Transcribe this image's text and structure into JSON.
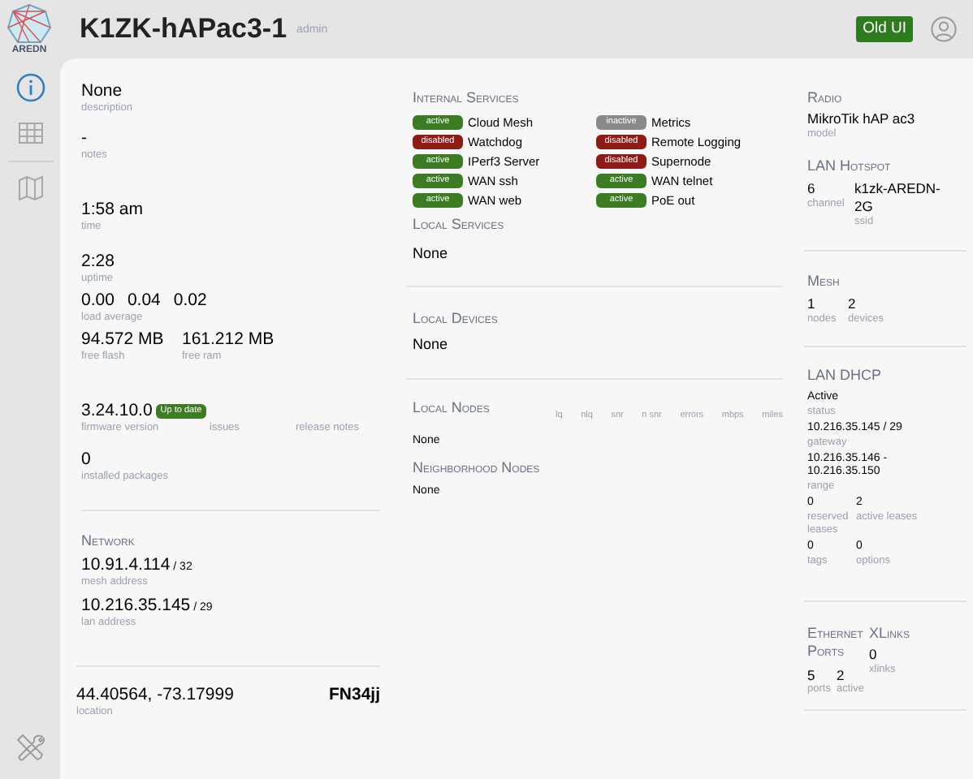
{
  "header": {
    "logo_text": "AREDN",
    "title": "K1ZK-hAPac3-1",
    "role": "admin",
    "old_ui_button": "Old UI"
  },
  "sidebar": {
    "items": [
      {
        "kind": "info",
        "selected": true
      },
      {
        "kind": "table",
        "selected": false
      },
      {
        "kind": "map",
        "selected": false
      }
    ]
  },
  "general": {
    "description": {
      "value": "None",
      "label": "description"
    },
    "notes": {
      "value": "-",
      "label": "notes"
    },
    "time": {
      "value": "1:58 am",
      "label": "time"
    },
    "uptime": {
      "value": "2:28",
      "label": "uptime"
    },
    "load_average": {
      "values": [
        "0.00",
        "0.04",
        "0.02"
      ],
      "label": "load average"
    },
    "memory": [
      {
        "value": "94.572 MB",
        "label": "free flash"
      },
      {
        "value": "161.212 MB",
        "label": "free ram"
      }
    ],
    "firmware": {
      "value": "3.24.10.0",
      "badge": "Up to date",
      "label": "firmware version",
      "issues": "issues",
      "release_notes": "release notes"
    },
    "packages": {
      "value": "0",
      "label": "installed packages"
    }
  },
  "network": {
    "title": "Network",
    "addresses": [
      {
        "value": "10.91.4.114",
        "mask": "/ 32",
        "label": "mesh address"
      },
      {
        "value": "10.216.35.145",
        "mask": "/ 29",
        "label": "lan address"
      }
    ]
  },
  "location": {
    "coordinates": "44.40564, -73.17999",
    "label": "location",
    "grid_square": "FN34jj"
  },
  "internal_services": {
    "title": "Internal Services",
    "columns": [
      [
        {
          "status": "active",
          "name": "Cloud Mesh"
        },
        {
          "status": "disabled",
          "name": "Watchdog"
        },
        {
          "status": "active",
          "name": "IPerf3 Server"
        },
        {
          "status": "active",
          "name": "WAN ssh"
        },
        {
          "status": "active",
          "name": "WAN web"
        }
      ],
      [
        {
          "status": "inactive",
          "name": "Metrics"
        },
        {
          "status": "disabled",
          "name": "Remote Logging"
        },
        {
          "status": "disabled",
          "name": "Supernode"
        },
        {
          "status": "active",
          "name": "WAN telnet"
        },
        {
          "status": "active",
          "name": "PoE out"
        }
      ]
    ]
  },
  "local_services": {
    "title": "Local Services",
    "value": "None"
  },
  "local_devices": {
    "title": "Local Devices",
    "value": "None"
  },
  "local_nodes": {
    "title": "Local Nodes",
    "columns": [
      "lq",
      "nlq",
      "snr",
      "n snr",
      "errors",
      "mbps",
      "miles"
    ],
    "value": "None"
  },
  "neighborhood_nodes": {
    "title": "Neighborhood Nodes",
    "value": "None"
  },
  "radio": {
    "title": "Radio",
    "model": {
      "value": "MikroTik hAP ac3",
      "label": "model"
    }
  },
  "lan_hotspot": {
    "title": "LAN Hotspot",
    "fields": [
      {
        "value": "6",
        "label": "channel"
      },
      {
        "value": "k1zk-AREDN-2G",
        "label": "ssid"
      }
    ]
  },
  "mesh": {
    "title": "Mesh",
    "fields": [
      {
        "value": "1",
        "label": "nodes"
      },
      {
        "value": "2",
        "label": "devices"
      }
    ]
  },
  "lan_dhcp": {
    "title": "LAN DHCP",
    "status": {
      "value": "Active",
      "label": "status"
    },
    "gateway": {
      "value": "10.216.35.145",
      "mask": "/ 29",
      "label": "gateway"
    },
    "range": {
      "value": "10.216.35.146 - 10.216.35.150",
      "label": "range"
    },
    "fields": [
      {
        "value": "0",
        "label": "reserved leases"
      },
      {
        "value": "2",
        "label": "active leases"
      },
      {
        "value": "0",
        "label": "tags"
      },
      {
        "value": "0",
        "label": "options"
      }
    ]
  },
  "ethernet_ports": {
    "title": "Ethernet Ports",
    "fields": [
      {
        "value": "5",
        "label": "ports"
      },
      {
        "value": "2",
        "label": "active"
      }
    ]
  },
  "xlinks": {
    "title": "XLinks",
    "value": "0",
    "label": "xlinks"
  }
}
